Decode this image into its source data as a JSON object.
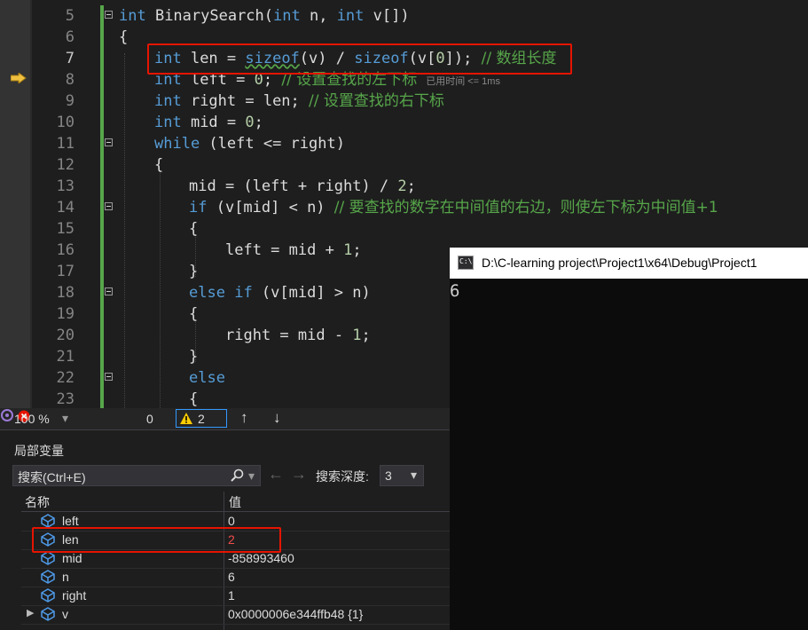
{
  "editor": {
    "lines": [
      {
        "num": "5"
      },
      {
        "num": "6"
      },
      {
        "num": "7"
      },
      {
        "num": "8"
      },
      {
        "num": "9"
      },
      {
        "num": "10"
      },
      {
        "num": "11"
      },
      {
        "num": "12"
      },
      {
        "num": "13"
      },
      {
        "num": "14"
      },
      {
        "num": "15"
      },
      {
        "num": "16"
      },
      {
        "num": "17"
      },
      {
        "num": "18"
      },
      {
        "num": "19"
      },
      {
        "num": "20"
      },
      {
        "num": "21"
      },
      {
        "num": "22"
      },
      {
        "num": "23"
      }
    ],
    "code": {
      "l5_kw1": "int",
      "l5_name": " BinarySearch(",
      "l5_kw2": "int",
      "l5_mid": " n, ",
      "l5_kw3": "int",
      "l5_end": " v[])",
      "l6": "{",
      "l7_kw": "int",
      "l7_a": " len = ",
      "l7_sz1": "sizeof",
      "l7_b": "(",
      "l7_v1": "v",
      "l7_c": ") / ",
      "l7_sz2": "sizeof",
      "l7_d": "(v[",
      "l7_zero": "0",
      "l7_e": "]); ",
      "l7_cm": "// 数组长度",
      "l8_kw": "int",
      "l8_a": " left = ",
      "l8_zero": "0",
      "l8_b": "; ",
      "l8_cm": "// 设置查找的左下标",
      "l8_hint": "已用时间 <= 1ms",
      "l9_kw": "int",
      "l9_a": " right = len; ",
      "l9_cm": "// 设置查找的右下标",
      "l10_kw": "int",
      "l10_a": " mid = ",
      "l10_zero": "0",
      "l10_b": ";",
      "l11_kw": "while",
      "l11_a": " (left <= right)",
      "l12": "{",
      "l13_a": "mid = (left + right) / ",
      "l13_two": "2",
      "l13_b": ";",
      "l14_kw": "if",
      "l14_a": " (v[mid] < n) ",
      "l14_cm": "// 要查找的数字在中间值的右边，则使左下标为中间值+1",
      "l15": "{",
      "l16_a": "left = mid + ",
      "l16_one": "1",
      "l16_b": ";",
      "l17": "}",
      "l18_kw1": "else",
      "l18_sp": " ",
      "l18_kw2": "if",
      "l18_a": " (v[mid] > n)",
      "l19": "{",
      "l20_a": "right = mid - ",
      "l20_one": "1",
      "l20_b": ";",
      "l21": "}",
      "l22_kw": "else",
      "l23": "{"
    }
  },
  "status": {
    "zoom": "100 %",
    "errors": "0",
    "warnings": "2"
  },
  "locals": {
    "title": "局部变量",
    "search_placeholder": "搜索(Ctrl+E)",
    "search_depth_label": "搜索深度:",
    "search_depth_value": "3",
    "col_name": "名称",
    "col_value": "值",
    "rows": [
      {
        "name": "left",
        "value": "0"
      },
      {
        "name": "len",
        "value": "2"
      },
      {
        "name": "mid",
        "value": "-858993460"
      },
      {
        "name": "n",
        "value": "6"
      },
      {
        "name": "right",
        "value": "1"
      },
      {
        "name": "v",
        "value": "0x0000006e344ffb48 {1}"
      }
    ],
    "changed_color": "#f14c4c"
  },
  "console": {
    "title": "D:\\C-learning project\\Project1\\x64\\Debug\\Project1",
    "output": "6"
  },
  "colors": {
    "keyword": "#569cd6",
    "comment": "#57a64a",
    "highlight_box": "#e51400"
  }
}
